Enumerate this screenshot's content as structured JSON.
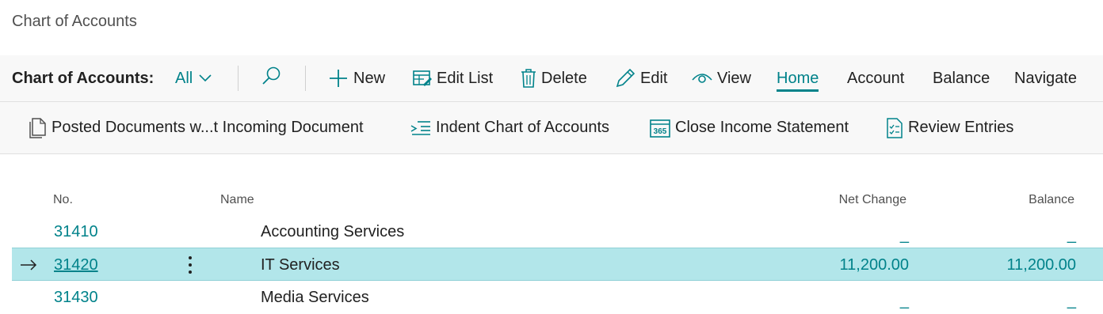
{
  "page": {
    "title": "Chart of Accounts"
  },
  "action_bar": {
    "caption": "Chart of Accounts:",
    "filter": "All",
    "actions": [
      "New",
      "Edit List",
      "Delete",
      "Edit",
      "View"
    ],
    "tabs": [
      "Home",
      "Account",
      "Balance",
      "Navigate"
    ],
    "active_tab": "Home"
  },
  "sub_actions": [
    "Posted Documents w...t Incoming Document",
    "Indent Chart of Accounts",
    "Close Income Statement",
    "Review Entries"
  ],
  "grid": {
    "columns": {
      "no": "No.",
      "name": "Name",
      "net_change": "Net Change",
      "balance": "Balance"
    },
    "rows": [
      {
        "no": "31410",
        "name": "Accounting Services",
        "net_change": "_",
        "balance": "_"
      },
      {
        "no": "31420",
        "name": "IT Services",
        "net_change": "11,200.00",
        "balance": "11,200.00",
        "selected": true
      },
      {
        "no": "31430",
        "name": "Media Services",
        "net_change": "_",
        "balance": "_"
      }
    ]
  },
  "colors": {
    "accent": "#00828a",
    "selected_row": "#b2e6ea"
  },
  "icons": [
    "chevron-down-icon",
    "search-icon",
    "plus-icon",
    "edit-list-icon",
    "trash-icon",
    "pencil-icon",
    "eye-icon",
    "document-icon",
    "indent-icon",
    "calendar-365-icon",
    "checklist-icon",
    "arrow-right-icon",
    "more-vertical-icon"
  ]
}
